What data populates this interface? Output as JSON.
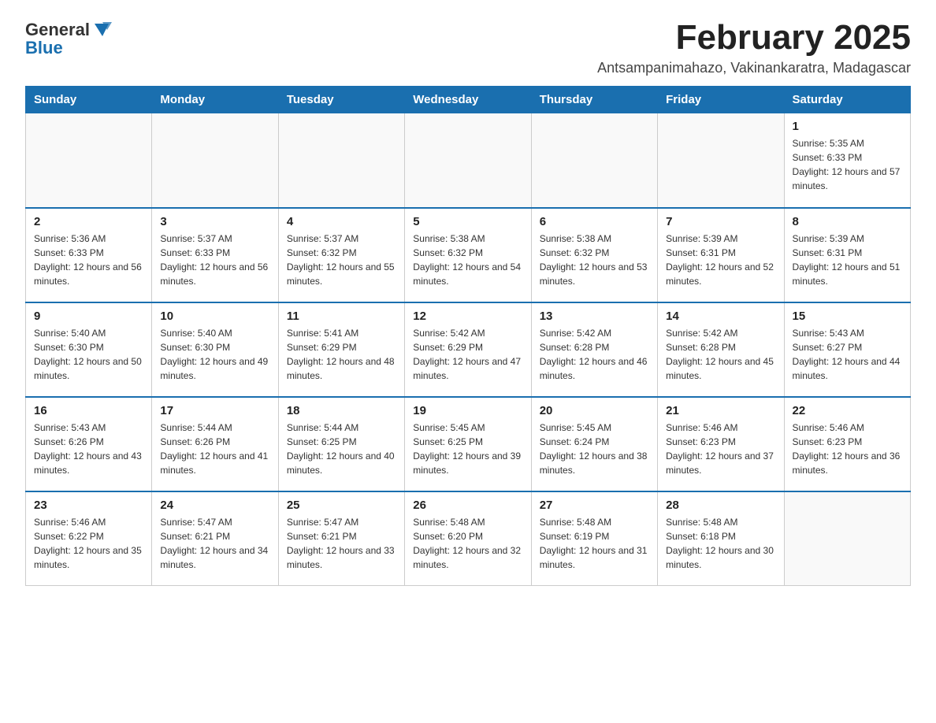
{
  "logo": {
    "general": "General",
    "blue": "Blue"
  },
  "header": {
    "title": "February 2025",
    "subtitle": "Antsampanimahazo, Vakinankaratra, Madagascar"
  },
  "weekdays": [
    "Sunday",
    "Monday",
    "Tuesday",
    "Wednesday",
    "Thursday",
    "Friday",
    "Saturday"
  ],
  "weeks": [
    [
      {
        "day": "",
        "info": ""
      },
      {
        "day": "",
        "info": ""
      },
      {
        "day": "",
        "info": ""
      },
      {
        "day": "",
        "info": ""
      },
      {
        "day": "",
        "info": ""
      },
      {
        "day": "",
        "info": ""
      },
      {
        "day": "1",
        "info": "Sunrise: 5:35 AM\nSunset: 6:33 PM\nDaylight: 12 hours and 57 minutes."
      }
    ],
    [
      {
        "day": "2",
        "info": "Sunrise: 5:36 AM\nSunset: 6:33 PM\nDaylight: 12 hours and 56 minutes."
      },
      {
        "day": "3",
        "info": "Sunrise: 5:37 AM\nSunset: 6:33 PM\nDaylight: 12 hours and 56 minutes."
      },
      {
        "day": "4",
        "info": "Sunrise: 5:37 AM\nSunset: 6:32 PM\nDaylight: 12 hours and 55 minutes."
      },
      {
        "day": "5",
        "info": "Sunrise: 5:38 AM\nSunset: 6:32 PM\nDaylight: 12 hours and 54 minutes."
      },
      {
        "day": "6",
        "info": "Sunrise: 5:38 AM\nSunset: 6:32 PM\nDaylight: 12 hours and 53 minutes."
      },
      {
        "day": "7",
        "info": "Sunrise: 5:39 AM\nSunset: 6:31 PM\nDaylight: 12 hours and 52 minutes."
      },
      {
        "day": "8",
        "info": "Sunrise: 5:39 AM\nSunset: 6:31 PM\nDaylight: 12 hours and 51 minutes."
      }
    ],
    [
      {
        "day": "9",
        "info": "Sunrise: 5:40 AM\nSunset: 6:30 PM\nDaylight: 12 hours and 50 minutes."
      },
      {
        "day": "10",
        "info": "Sunrise: 5:40 AM\nSunset: 6:30 PM\nDaylight: 12 hours and 49 minutes."
      },
      {
        "day": "11",
        "info": "Sunrise: 5:41 AM\nSunset: 6:29 PM\nDaylight: 12 hours and 48 minutes."
      },
      {
        "day": "12",
        "info": "Sunrise: 5:42 AM\nSunset: 6:29 PM\nDaylight: 12 hours and 47 minutes."
      },
      {
        "day": "13",
        "info": "Sunrise: 5:42 AM\nSunset: 6:28 PM\nDaylight: 12 hours and 46 minutes."
      },
      {
        "day": "14",
        "info": "Sunrise: 5:42 AM\nSunset: 6:28 PM\nDaylight: 12 hours and 45 minutes."
      },
      {
        "day": "15",
        "info": "Sunrise: 5:43 AM\nSunset: 6:27 PM\nDaylight: 12 hours and 44 minutes."
      }
    ],
    [
      {
        "day": "16",
        "info": "Sunrise: 5:43 AM\nSunset: 6:26 PM\nDaylight: 12 hours and 43 minutes."
      },
      {
        "day": "17",
        "info": "Sunrise: 5:44 AM\nSunset: 6:26 PM\nDaylight: 12 hours and 41 minutes."
      },
      {
        "day": "18",
        "info": "Sunrise: 5:44 AM\nSunset: 6:25 PM\nDaylight: 12 hours and 40 minutes."
      },
      {
        "day": "19",
        "info": "Sunrise: 5:45 AM\nSunset: 6:25 PM\nDaylight: 12 hours and 39 minutes."
      },
      {
        "day": "20",
        "info": "Sunrise: 5:45 AM\nSunset: 6:24 PM\nDaylight: 12 hours and 38 minutes."
      },
      {
        "day": "21",
        "info": "Sunrise: 5:46 AM\nSunset: 6:23 PM\nDaylight: 12 hours and 37 minutes."
      },
      {
        "day": "22",
        "info": "Sunrise: 5:46 AM\nSunset: 6:23 PM\nDaylight: 12 hours and 36 minutes."
      }
    ],
    [
      {
        "day": "23",
        "info": "Sunrise: 5:46 AM\nSunset: 6:22 PM\nDaylight: 12 hours and 35 minutes."
      },
      {
        "day": "24",
        "info": "Sunrise: 5:47 AM\nSunset: 6:21 PM\nDaylight: 12 hours and 34 minutes."
      },
      {
        "day": "25",
        "info": "Sunrise: 5:47 AM\nSunset: 6:21 PM\nDaylight: 12 hours and 33 minutes."
      },
      {
        "day": "26",
        "info": "Sunrise: 5:48 AM\nSunset: 6:20 PM\nDaylight: 12 hours and 32 minutes."
      },
      {
        "day": "27",
        "info": "Sunrise: 5:48 AM\nSunset: 6:19 PM\nDaylight: 12 hours and 31 minutes."
      },
      {
        "day": "28",
        "info": "Sunrise: 5:48 AM\nSunset: 6:18 PM\nDaylight: 12 hours and 30 minutes."
      },
      {
        "day": "",
        "info": ""
      }
    ]
  ]
}
